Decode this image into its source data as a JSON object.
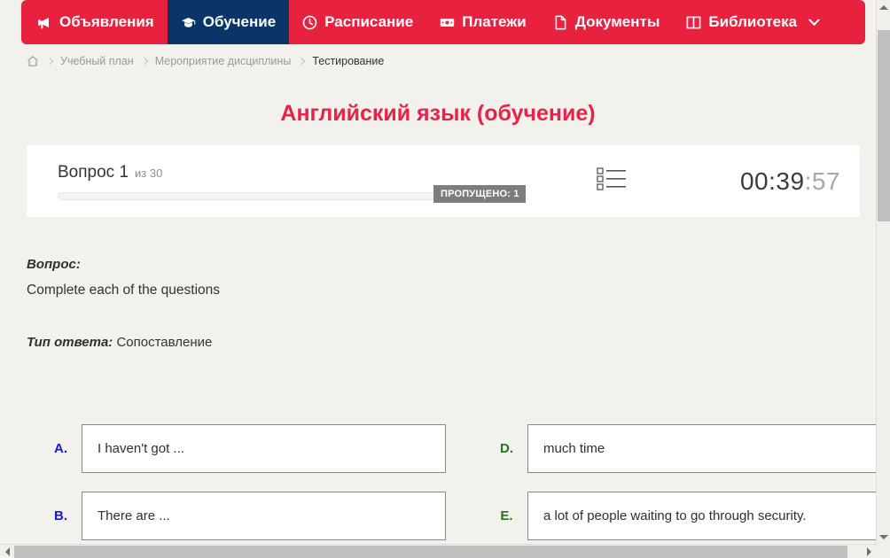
{
  "nav": {
    "items": [
      {
        "label": "Объявления",
        "icon": "megaphone-icon",
        "active": false,
        "caret": false
      },
      {
        "label": "Обучение",
        "icon": "graduation-cap-icon",
        "active": true,
        "caret": false
      },
      {
        "label": "Расписание",
        "icon": "clock-icon",
        "active": false,
        "caret": false
      },
      {
        "label": "Платежи",
        "icon": "banknote-icon",
        "active": false,
        "caret": false
      },
      {
        "label": "Документы",
        "icon": "document-icon",
        "active": false,
        "caret": false
      },
      {
        "label": "Библиотека",
        "icon": "book-icon",
        "active": false,
        "caret": true
      }
    ],
    "colors": {
      "bar": "#e8213f",
      "active": "#0b3568",
      "text": "#ffffff"
    }
  },
  "breadcrumb": {
    "home_icon": "home-icon",
    "items": [
      {
        "label": "Учебный план",
        "current": false
      },
      {
        "label": "Мероприятие дисциплины",
        "current": false
      },
      {
        "label": "Тестирование",
        "current": true
      }
    ]
  },
  "page": {
    "title": "Английский язык (обучение)",
    "title_color": "#e8224a"
  },
  "question_header": {
    "question_label": "Вопрос 1",
    "of_label": "из 30",
    "question_number": 1,
    "question_total": 30,
    "skipped_badge": "ПРОПУЩЕНО: 1",
    "skipped_count": 1,
    "badge_color": "#7d7d7d",
    "progress_percent": 0,
    "list_icon": "question-list-icon",
    "timer_main": "00:39",
    "timer_seconds": ":57",
    "timer_full": "00:39:57"
  },
  "question": {
    "prompt_label": "Вопрос:",
    "prompt_text": "Complete each of the questions",
    "answer_type_label": "Тип ответа:",
    "answer_type_value": "Сопоставление"
  },
  "matching": {
    "left": [
      {
        "letter": "A.",
        "text": "I haven't got ...",
        "color": "#1616e8"
      },
      {
        "letter": "B.",
        "text": "There are ...",
        "color": "#1616e8"
      }
    ],
    "right": [
      {
        "letter": "D.",
        "text": "much time",
        "color": "#1d7a1d"
      },
      {
        "letter": "E.",
        "text": "a lot of people waiting to go through security.",
        "color": "#1d7a1d"
      }
    ]
  },
  "scrollbars": {
    "vertical": {
      "up_icon": "scroll-up-arrow-icon",
      "down_icon": "scroll-down-arrow-icon"
    },
    "horizontal": {
      "left_icon": "scroll-left-arrow-icon",
      "right_icon": "scroll-right-arrow-icon"
    }
  }
}
